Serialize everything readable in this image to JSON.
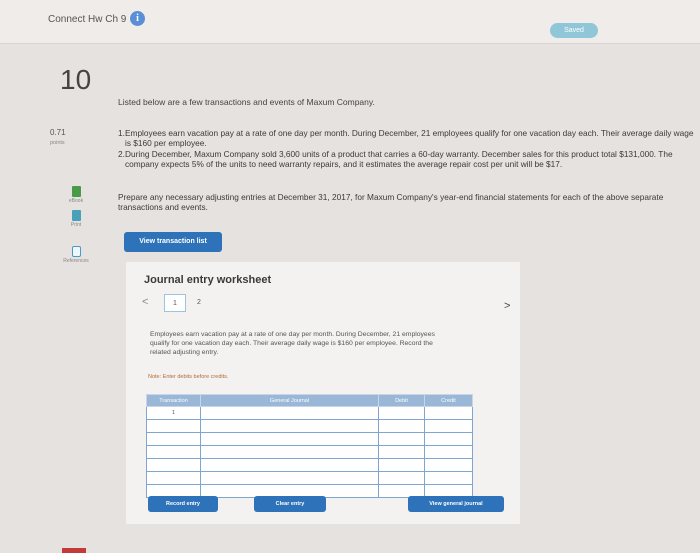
{
  "header": {
    "title": "Connect Hw Ch 9",
    "info_icon": "i",
    "saved": "Saved"
  },
  "question": {
    "number": "10",
    "points_value": "0.71",
    "points_label": "points",
    "intro": "Listed below are a few transactions and events of Maxum Company.",
    "items": [
      {
        "num": "1.",
        "text": "Employees earn vacation pay at a rate of one day per month. During December, 21 employees qualify for one vacation day each. Their average daily wage is $160 per employee."
      },
      {
        "num": "2.",
        "text": "During December, Maxum Company sold 3,600 units of a product that carries a 60-day warranty. December sales for this product total $131,000. The company expects 5% of the units to need warranty repairs, and it estimates the average repair cost per unit will be $17."
      }
    ],
    "instructions": "Prepare any necessary adjusting entries at December 31, 2017, for Maxum Company's year-end financial statements for each of the above separate transactions and events.",
    "view_transaction_list": "View transaction list"
  },
  "tools": {
    "ebook": "eBook",
    "print": "Print",
    "references": "References"
  },
  "worksheet": {
    "title": "Journal entry worksheet",
    "prev": "<",
    "next": ">",
    "pages": [
      "1",
      "2"
    ],
    "active_page": "1",
    "description": "Employees earn vacation pay at a rate of one day per month. During December, 21 employees qualify for one vacation day each. Their average daily wage is $160 per employee. Record the related adjusting entry.",
    "note": "Note: Enter debits before credits.",
    "table": {
      "headers": [
        "Transaction",
        "General Journal",
        "Debit",
        "Credit"
      ],
      "rows": [
        [
          "1",
          "",
          "",
          ""
        ],
        [
          "",
          "",
          "",
          ""
        ],
        [
          "",
          "",
          "",
          ""
        ],
        [
          "",
          "",
          "",
          ""
        ],
        [
          "",
          "",
          "",
          ""
        ],
        [
          "",
          "",
          "",
          ""
        ],
        [
          "",
          "",
          "",
          ""
        ]
      ]
    },
    "buttons": {
      "record": "Record entry",
      "clear": "Clear entry",
      "view_journal": "View general journal"
    }
  },
  "colors": {
    "primary_button": "#2e73b9",
    "table_header": "#9ab7d8",
    "saved_badge": "#8fc7d8"
  }
}
